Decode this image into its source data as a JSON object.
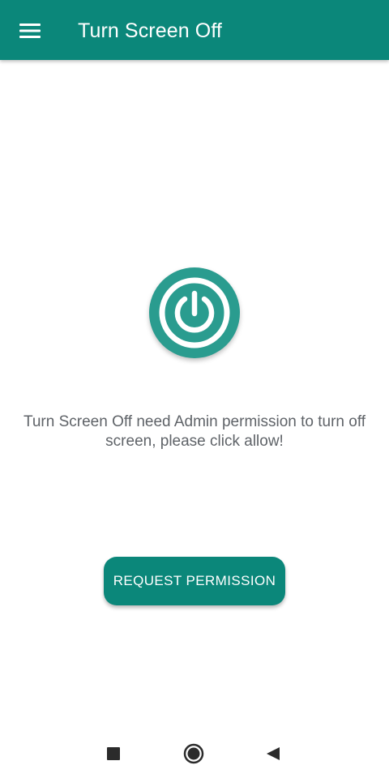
{
  "app_bar": {
    "title": "Turn Screen Off",
    "background_color": "#0b877a",
    "menu_icon": "hamburger-menu-icon"
  },
  "logo": {
    "icon": "power-icon",
    "color": "#2a9c8f"
  },
  "main": {
    "permission_message": "Turn Screen Off need Admin permission to turn off screen, please click allow!",
    "request_button_label": "REQUEST PERMISSION",
    "request_button_color": "#0b877a"
  },
  "nav_bar": {
    "recents_icon": "square-recents-icon",
    "home_icon": "circle-home-icon",
    "back_icon": "triangle-back-icon"
  }
}
